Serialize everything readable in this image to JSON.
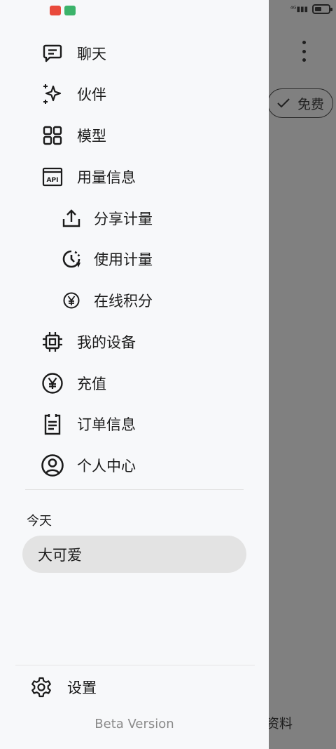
{
  "background": {
    "chip_label": "免费",
    "bottom_text": "资料"
  },
  "nav": {
    "items": [
      {
        "label": "聊天",
        "icon": "chat-icon"
      },
      {
        "label": "伙伴",
        "icon": "sparkle-icon"
      },
      {
        "label": "模型",
        "icon": "grid-icon"
      },
      {
        "label": "用量信息",
        "icon": "api-icon"
      },
      {
        "label": "分享计量",
        "icon": "share-upload-icon"
      },
      {
        "label": "使用计量",
        "icon": "history-clock-icon"
      },
      {
        "label": "在线积分",
        "icon": "yen-coin-icon"
      },
      {
        "label": "我的设备",
        "icon": "chip-icon"
      },
      {
        "label": "充值",
        "icon": "yen-circle-icon"
      },
      {
        "label": "订单信息",
        "icon": "clipboard-icon"
      },
      {
        "label": "个人中心",
        "icon": "account-icon"
      }
    ]
  },
  "history": {
    "section": "今天",
    "items": [
      {
        "label": "大可爱"
      }
    ]
  },
  "settings": {
    "label": "设置"
  },
  "version": "Beta Version",
  "colors": {
    "drawer_bg": "#f7f8fa",
    "scrim": "#808080",
    "selected_bg": "#e3e3e3"
  }
}
